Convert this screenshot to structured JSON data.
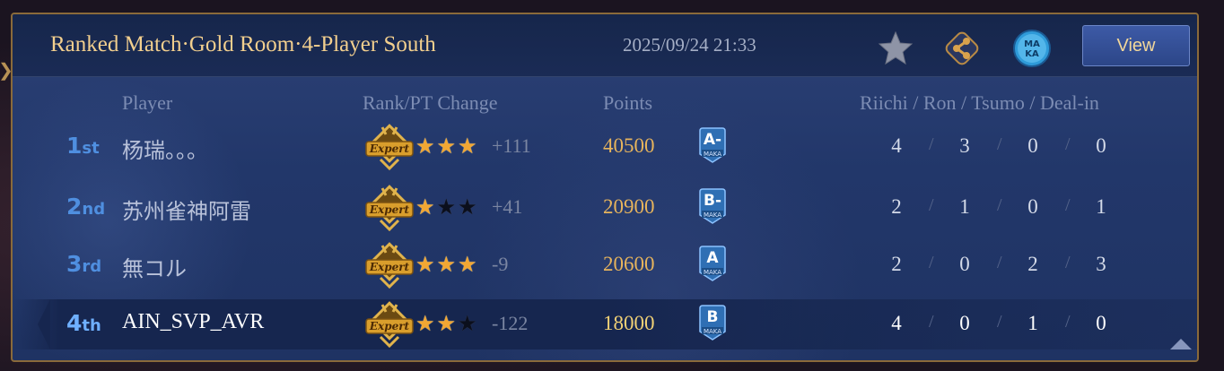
{
  "header": {
    "title": "Ranked Match·Gold Room·4-Player South",
    "date": "2025/09/24 21:33",
    "view_label": "View",
    "maka_icon_text_top": "MA",
    "maka_icon_text_bottom": "KA"
  },
  "columns": {
    "player": "Player",
    "rank_pt": "Rank/PT Change",
    "points": "Points",
    "stats": "Riichi / Ron / Tsumo / Deal-in"
  },
  "rank_badge_text": "Expert",
  "rating_sub": "MAKA",
  "players": [
    {
      "place_num": "1",
      "place_suffix": "st",
      "name": "杨瑞。。。",
      "stars": 3,
      "max_stars": 3,
      "delta": "+111",
      "points": "40500",
      "rating": "A-",
      "riichi": "4",
      "ron": "3",
      "tsumo": "0",
      "dealin": "0",
      "is_self": false
    },
    {
      "place_num": "2",
      "place_suffix": "nd",
      "name": "苏州雀神阿雷",
      "stars": 1,
      "max_stars": 3,
      "delta": "+41",
      "points": "20900",
      "rating": "B-",
      "riichi": "2",
      "ron": "1",
      "tsumo": "0",
      "dealin": "1",
      "is_self": false
    },
    {
      "place_num": "3",
      "place_suffix": "rd",
      "name": "無コル",
      "stars": 3,
      "max_stars": 3,
      "delta": "-9",
      "points": "20600",
      "rating": "A",
      "riichi": "2",
      "ron": "0",
      "tsumo": "2",
      "dealin": "3",
      "is_self": false
    },
    {
      "place_num": "4",
      "place_suffix": "th",
      "name": "AIN_SVP_AVR",
      "stars": 2,
      "max_stars": 3,
      "delta": "-122",
      "points": "18000",
      "rating": "B",
      "riichi": "4",
      "ron": "0",
      "tsumo": "1",
      "dealin": "0",
      "is_self": true
    }
  ],
  "colors": {
    "title": "#f2cf8e",
    "points": "#e7b45c",
    "place": "#4f8fe0",
    "star_on": "#f2a733",
    "panel_border": "#8a6a3a"
  }
}
